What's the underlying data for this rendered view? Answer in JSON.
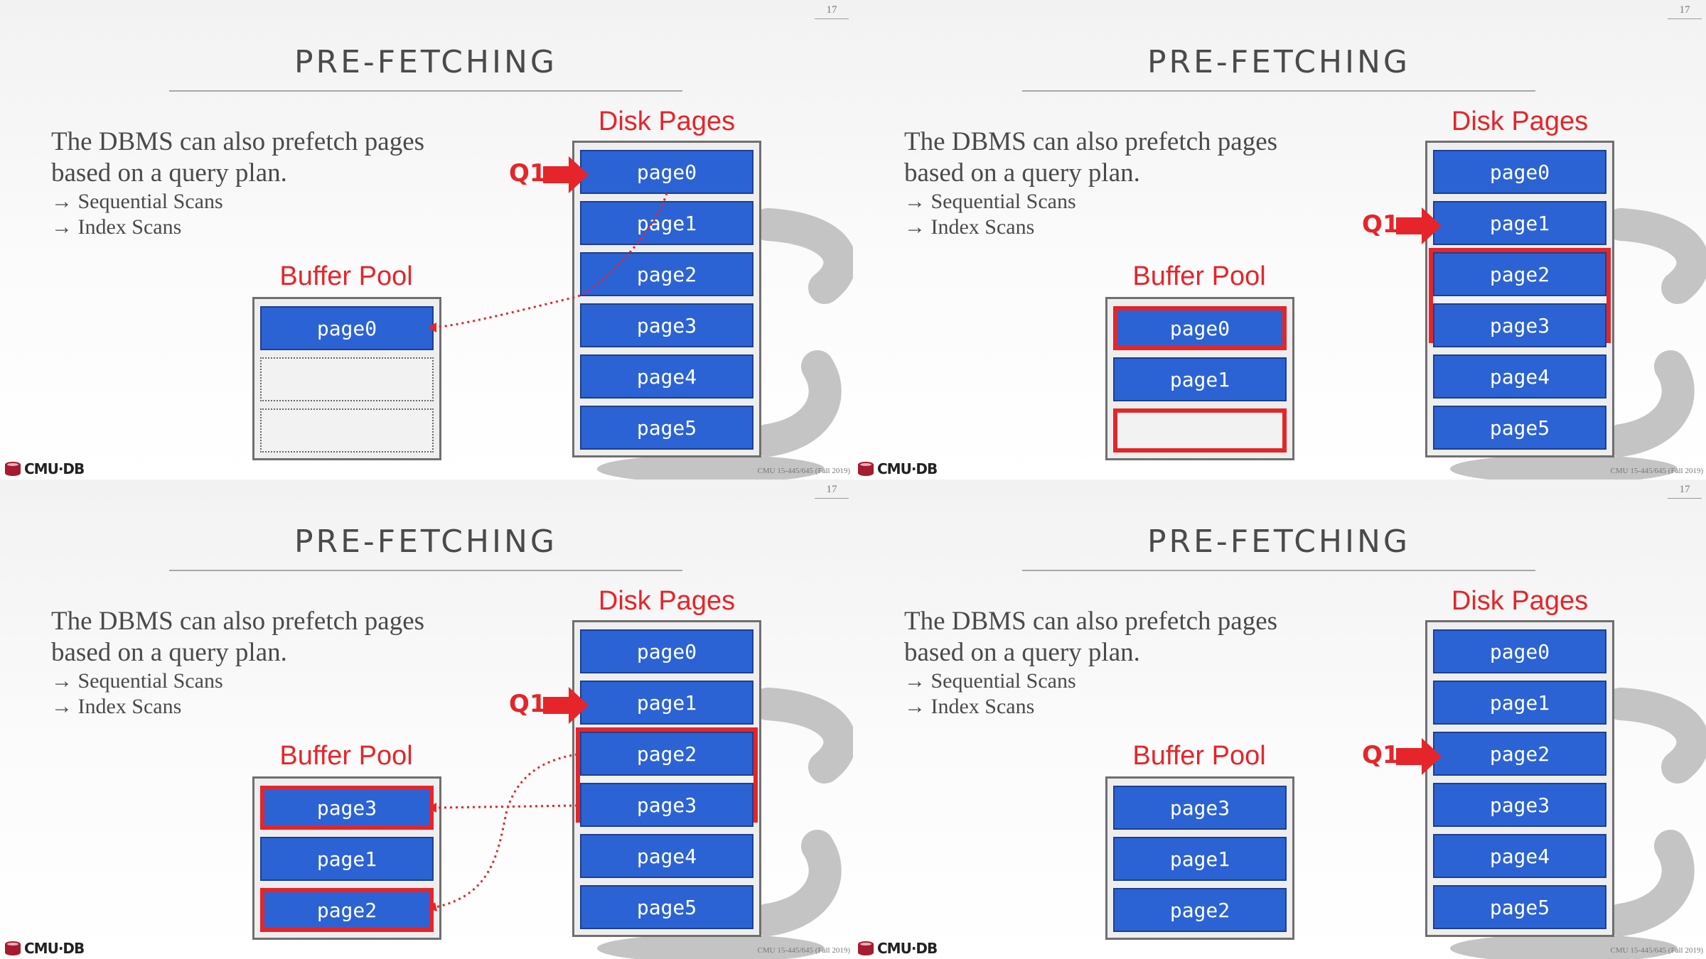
{
  "slides": [
    {
      "number": "17",
      "title": "PRE-FETCHING",
      "body": {
        "line1": "The DBMS can also prefetch pages",
        "line2": "based on a query plan.",
        "bullets": [
          "→ Sequential Scans",
          "→ Index Scans"
        ]
      },
      "buffer_pool": {
        "label": "Buffer Pool",
        "slots": [
          "page0",
          "",
          ""
        ]
      },
      "disk_pages": {
        "label": "Disk Pages",
        "pages": [
          "page0",
          "page1",
          "page2",
          "page3",
          "page4",
          "page5"
        ]
      },
      "q1_label": "Q1",
      "logo_text": "CMU·DB",
      "footer": "CMU 15-445/645 (Fall 2019)"
    },
    {
      "number": "17",
      "title": "PRE-FETCHING",
      "body": {
        "line1": "The DBMS can also prefetch pages",
        "line2": "based on a query plan.",
        "bullets": [
          "→ Sequential Scans",
          "→ Index Scans"
        ]
      },
      "buffer_pool": {
        "label": "Buffer Pool",
        "slots": [
          "page0",
          "page1",
          ""
        ]
      },
      "disk_pages": {
        "label": "Disk Pages",
        "pages": [
          "page0",
          "page1",
          "page2",
          "page3",
          "page4",
          "page5"
        ]
      },
      "q1_label": "Q1",
      "logo_text": "CMU·DB",
      "footer": "CMU 15-445/645 (Fall 2019)"
    },
    {
      "number": "17",
      "title": "PRE-FETCHING",
      "body": {
        "line1": "The DBMS can also prefetch pages",
        "line2": "based on a query plan.",
        "bullets": [
          "→ Sequential Scans",
          "→ Index Scans"
        ]
      },
      "buffer_pool": {
        "label": "Buffer Pool",
        "slots": [
          "page3",
          "page1",
          "page2"
        ]
      },
      "disk_pages": {
        "label": "Disk Pages",
        "pages": [
          "page0",
          "page1",
          "page2",
          "page3",
          "page4",
          "page5"
        ]
      },
      "q1_label": "Q1",
      "logo_text": "CMU·DB",
      "footer": "CMU 15-445/645 (Fall 2019)"
    },
    {
      "number": "17",
      "title": "PRE-FETCHING",
      "body": {
        "line1": "The DBMS can also prefetch pages",
        "line2": "based on a query plan.",
        "bullets": [
          "→ Sequential Scans",
          "→ Index Scans"
        ]
      },
      "buffer_pool": {
        "label": "Buffer Pool",
        "slots": [
          "page3",
          "page1",
          "page2"
        ]
      },
      "disk_pages": {
        "label": "Disk Pages",
        "pages": [
          "page0",
          "page1",
          "page2",
          "page3",
          "page4",
          "page5"
        ]
      },
      "q1_label": "Q1",
      "logo_text": "CMU·DB",
      "footer": "CMU 15-445/645 (Fall 2019)"
    }
  ],
  "colors": {
    "accent_red": "#e5252a",
    "page_blue": "#2c63d4",
    "title_gray": "#4a4a4a",
    "frame_gray": "#6f6f6f"
  },
  "icons": {
    "logo": "cmu-db-logo-icon",
    "q1_pointer": "arrow-right-icon",
    "background": "database-cylinder-icon"
  }
}
